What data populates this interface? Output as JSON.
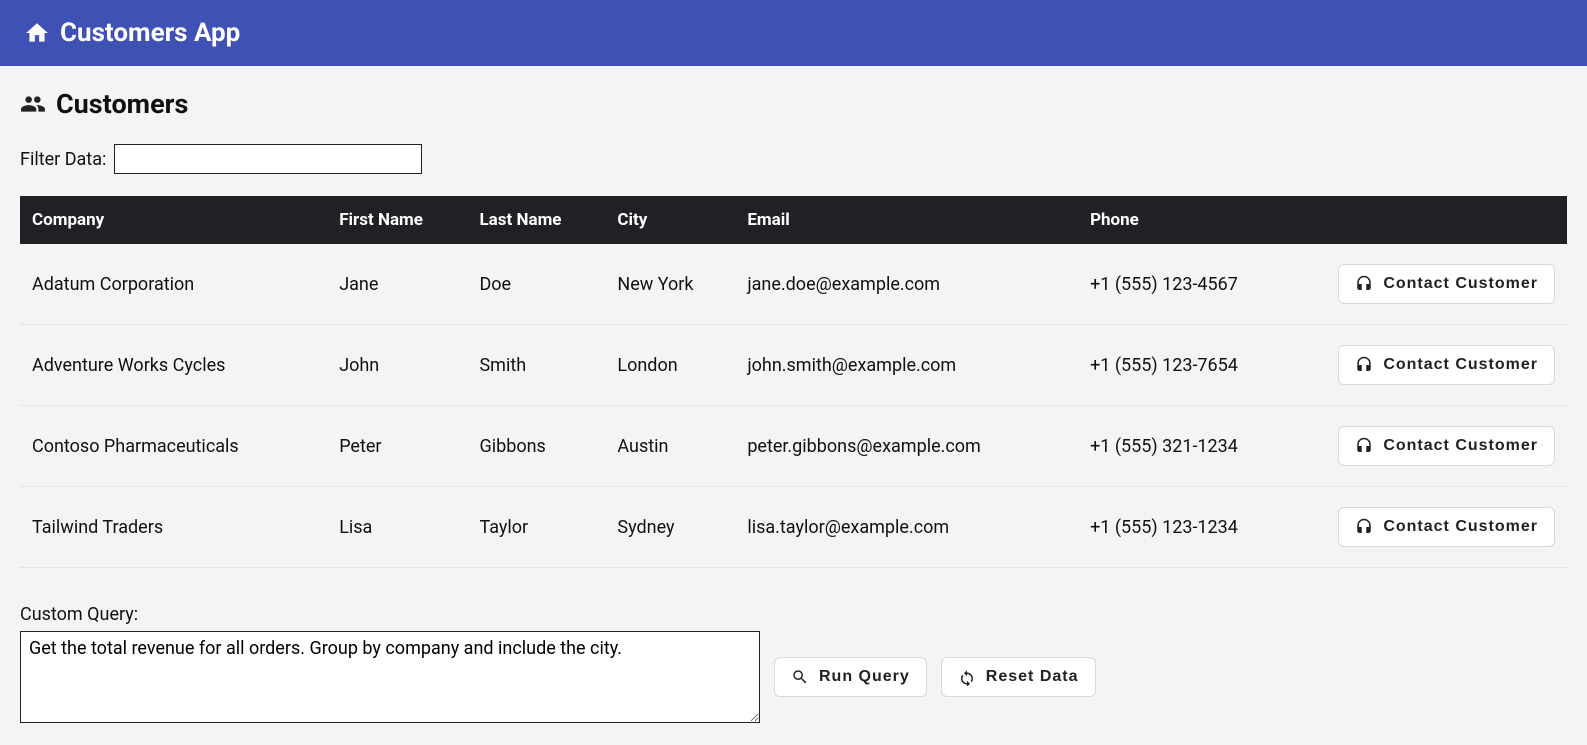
{
  "header": {
    "title": "Customers App"
  },
  "page": {
    "title": "Customers",
    "filter_label": "Filter Data:",
    "filter_value": ""
  },
  "table": {
    "columns": [
      "Company",
      "First Name",
      "Last Name",
      "City",
      "Email",
      "Phone"
    ],
    "action_label": "Contact Customer",
    "rows": [
      {
        "company": "Adatum Corporation",
        "first": "Jane",
        "last": "Doe",
        "city": "New York",
        "email": "jane.doe@example.com",
        "phone": "+1 (555) 123-4567"
      },
      {
        "company": "Adventure Works Cycles",
        "first": "John",
        "last": "Smith",
        "city": "London",
        "email": "john.smith@example.com",
        "phone": "+1 (555) 123-7654"
      },
      {
        "company": "Contoso Pharmaceuticals",
        "first": "Peter",
        "last": "Gibbons",
        "city": "Austin",
        "email": "peter.gibbons@example.com",
        "phone": "+1 (555) 321-1234"
      },
      {
        "company": "Tailwind Traders",
        "first": "Lisa",
        "last": "Taylor",
        "city": "Sydney",
        "email": "lisa.taylor@example.com",
        "phone": "+1 (555) 123-1234"
      }
    ]
  },
  "query": {
    "label": "Custom Query:",
    "value": "Get the total revenue for all orders. Group by company and include the city.",
    "run_label": "Run Query",
    "reset_label": "Reset Data"
  }
}
